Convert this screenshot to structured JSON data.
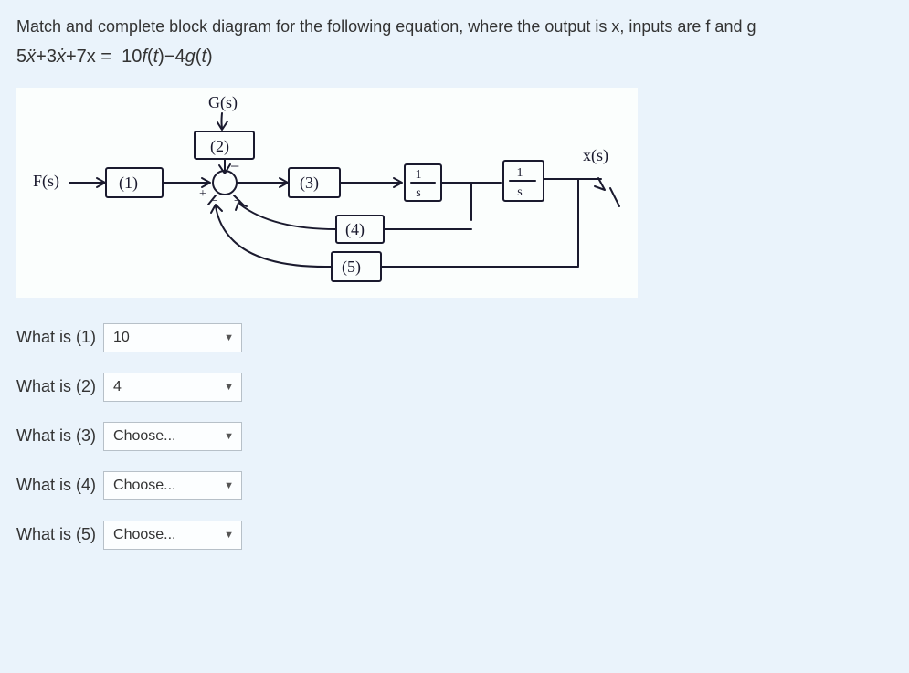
{
  "prompt": "Match and complete block diagram for the following equation, where the output is x, inputs are f and g",
  "equationParts": {
    "lhs1": "5",
    "xddot": "ẍ",
    "plus1": "+",
    "lhs2": "3",
    "xdot": "ẋ",
    "plus2": "+",
    "lhs3": "7x",
    "eq": " = ",
    "rhs1": "10",
    "f": "f",
    "tf": "(",
    "tvar": "t",
    "tf2": ")",
    "minus": "−",
    "rhs2": "4",
    "g": "g",
    "tg": "(",
    "tvar2": "t",
    "tg2": ")"
  },
  "diagram": {
    "Gs": "G(s)",
    "Fs": "F(s)",
    "xs": "x(s)",
    "b1": "(1)",
    "b2": "(2)",
    "b3": "(3)",
    "b4": "(4)",
    "b5": "(5)",
    "sj_plus": "+",
    "sj_minus": "−",
    "integ_num": "1",
    "integ_den": "s"
  },
  "questions": [
    {
      "label": "What is (1)",
      "value": "10"
    },
    {
      "label": "What is (2)",
      "value": "4"
    },
    {
      "label": "What is (3)",
      "value": "Choose..."
    },
    {
      "label": "What is (4)",
      "value": "Choose..."
    },
    {
      "label": "What is (5)",
      "value": "Choose..."
    }
  ]
}
